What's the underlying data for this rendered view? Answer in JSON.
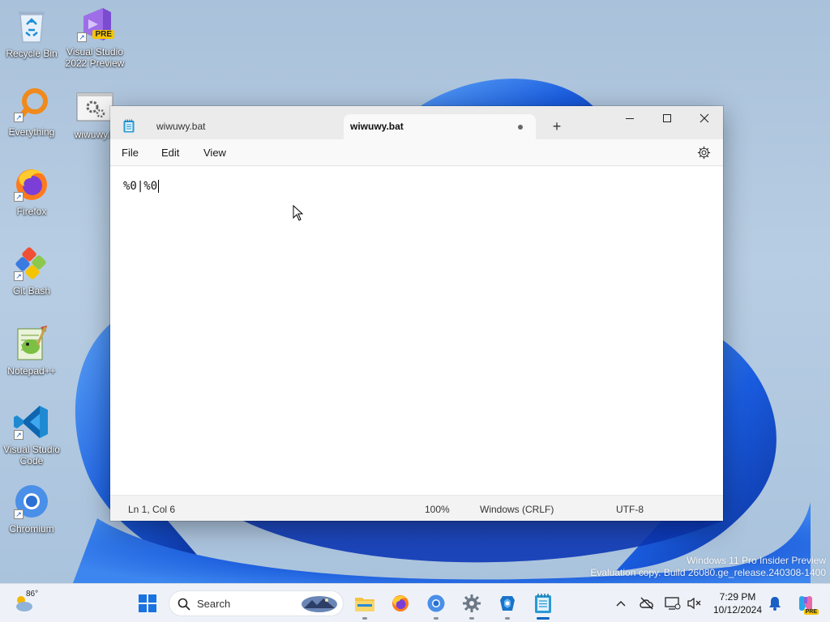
{
  "desktop": {
    "icons": [
      {
        "label": "Recycle Bin"
      },
      {
        "label": "Visual Studio 2022 Preview",
        "line1": "Visual Studio",
        "line2": "2022 Preview",
        "badge": "PRE"
      },
      {
        "label": "Everything"
      },
      {
        "label": "wiwuwy.bat",
        "display": "wiwuwy.b"
      },
      {
        "label": "Firefox"
      },
      {
        "label": "Git Bash"
      },
      {
        "label": "Notepad++"
      },
      {
        "label": "Visual Studio Code",
        "line1": "Visual Studio",
        "line2": "Code"
      },
      {
        "label": "Chromium"
      }
    ],
    "watermark": {
      "line1": "Windows 11 Pro Insider Preview",
      "line2": "Evaluation copy. Build 26080.ge_release.240308-1400"
    }
  },
  "notepad": {
    "tabs": [
      {
        "title": "wiwuwy.bat",
        "active": false
      },
      {
        "title": "wiwuwy.bat",
        "active": true,
        "unsaved": true
      }
    ],
    "new_tab_label": "+",
    "menu": [
      "File",
      "Edit",
      "View"
    ],
    "content": "%0|%0",
    "status": {
      "position": "Ln 1, Col 6",
      "zoom": "100%",
      "line_ending": "Windows (CRLF)",
      "encoding": "UTF-8"
    }
  },
  "taskbar": {
    "weather_temp": "86°",
    "search_placeholder": "Search",
    "apps": [
      "start-icon",
      "file-explorer-icon",
      "firefox-icon",
      "chromium-icon",
      "settings-icon",
      "devtool-icon",
      "notepad-icon"
    ],
    "clock": {
      "time": "7:29 PM",
      "date": "10/12/2024"
    },
    "copilot_badge": "PRE"
  },
  "colors": {
    "accent": "#0067c0",
    "wallpaper_blue": "#1a56d6"
  }
}
